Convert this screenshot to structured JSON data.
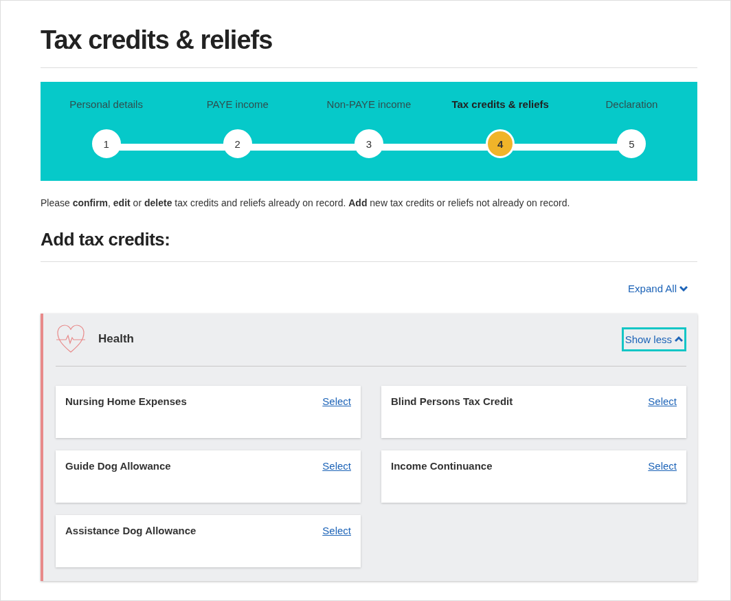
{
  "page_title": "Tax credits & reliefs",
  "steps": [
    {
      "label": "Personal details",
      "number": "1",
      "selected": false
    },
    {
      "label": "PAYE income",
      "number": "2",
      "selected": false
    },
    {
      "label": "Non-PAYE income",
      "number": "3",
      "selected": false
    },
    {
      "label": "Tax credits & reliefs",
      "number": "4",
      "selected": true
    },
    {
      "label": "Declaration",
      "number": "5",
      "selected": false
    }
  ],
  "intro": "Please **confirm**, **edit** or **delete** tax credits and reliefs already on record. **Add** new tax credits or reliefs not already on record.",
  "section_heading": "Add tax credits:",
  "expand_all": "Expand All",
  "category": {
    "title": "Health",
    "toggle": "Show less",
    "expanded": true,
    "color": "#e88a8a",
    "items": [
      {
        "name": "Nursing Home Expenses",
        "action": "Select"
      },
      {
        "name": "Blind Persons Tax Credit",
        "action": "Select"
      },
      {
        "name": "Guide Dog Allowance",
        "action": "Select"
      },
      {
        "name": "Income Continuance",
        "action": "Select"
      },
      {
        "name": "Assistance Dog Allowance",
        "action": "Select"
      }
    ]
  }
}
